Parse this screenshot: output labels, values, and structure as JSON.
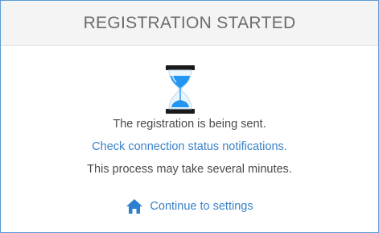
{
  "header": {
    "title": "REGISTRATION STARTED"
  },
  "status": {
    "icon": "hourglass-icon",
    "message": "The registration is being sent.",
    "link_text": "Check connection status notifications.",
    "note": "This process may take several minutes."
  },
  "actions": {
    "continue_label": "Continue to settings",
    "continue_icon": "home-icon"
  },
  "colors": {
    "accent": "#3a82c8",
    "border": "#5b9bd5",
    "header_bg": "#f4f4f4",
    "hourglass_sand": "#2196f3"
  }
}
